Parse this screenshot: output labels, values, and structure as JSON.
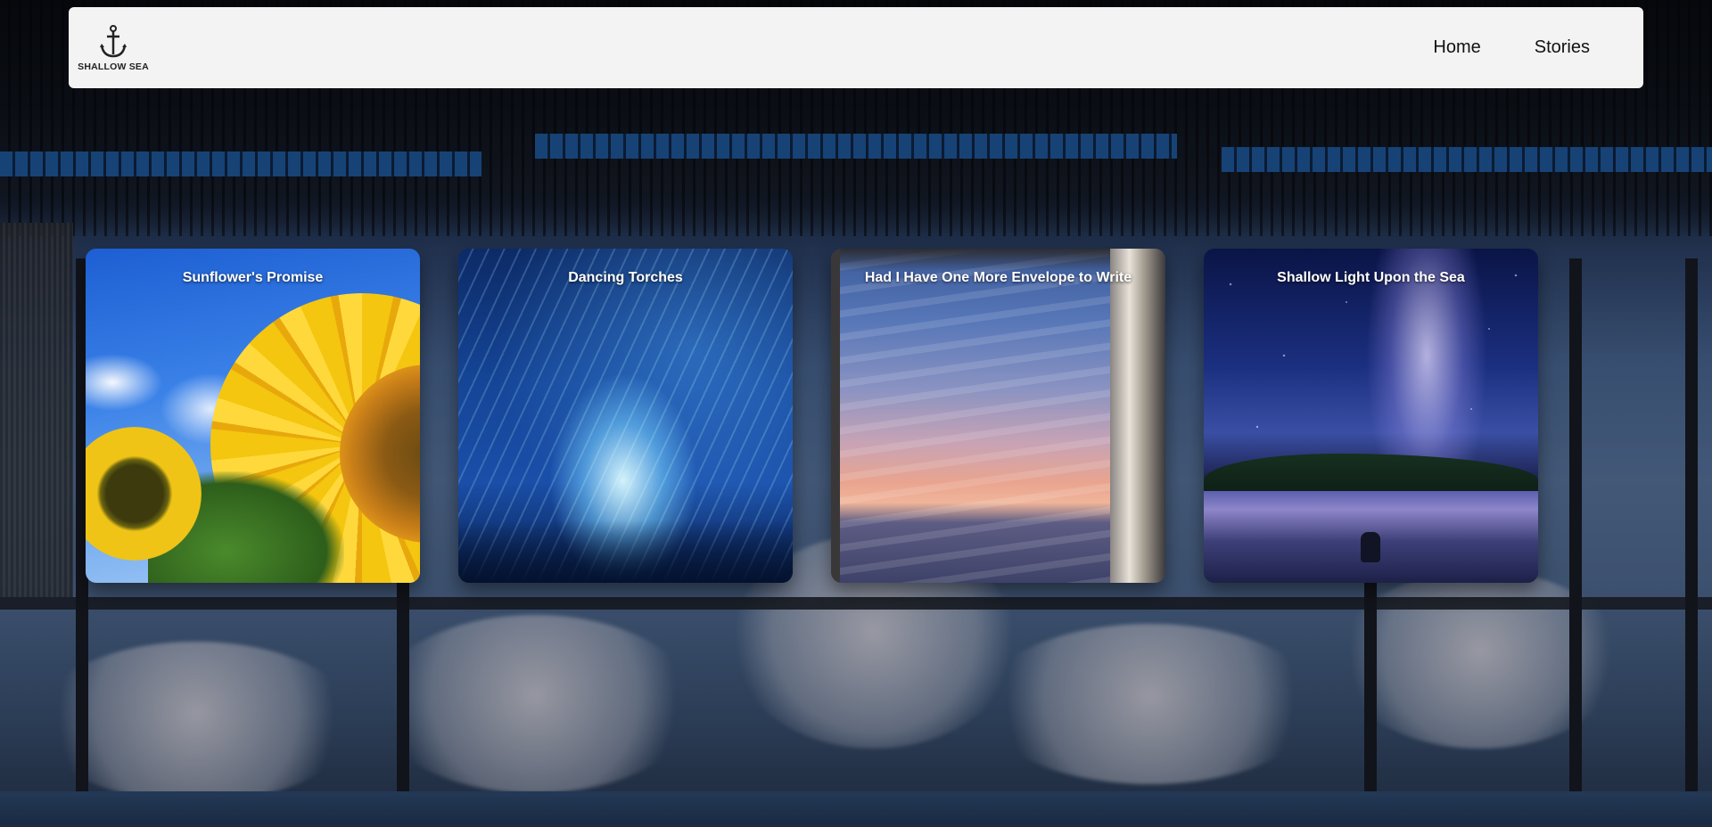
{
  "brand": {
    "logo_text": "SHALLOW SEA",
    "logo_icon": "anchor-icon"
  },
  "nav": {
    "items": [
      {
        "label": "Home"
      },
      {
        "label": "Stories"
      }
    ]
  },
  "cards": [
    {
      "title": "Sunflower's Promise"
    },
    {
      "title": "Dancing Torches"
    },
    {
      "title": "Had I Have One More Envelope to Write"
    },
    {
      "title": "Shallow Light Upon the Sea"
    }
  ],
  "colors": {
    "header_bg": "#f3f3f3",
    "card_title": "#ffffff",
    "nav_text": "#111111"
  }
}
